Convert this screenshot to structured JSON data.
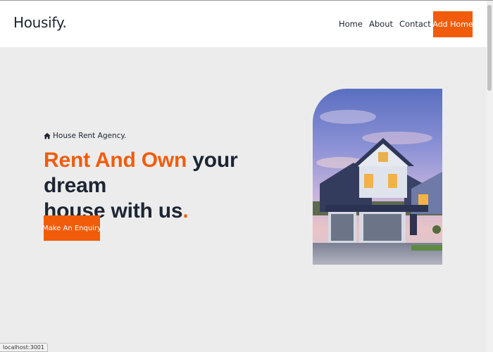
{
  "navbar": {
    "brand": "Housify.",
    "links": [
      "Home",
      "About",
      "Contact"
    ],
    "cta_label": "Add Home"
  },
  "hero": {
    "tagline": "House Rent Agency.",
    "headline_accent": "Rent And Own",
    "headline_rest_1": " your dream",
    "headline_rest_2": "house with us",
    "headline_dot": ".",
    "cta_label": "Make An Enquiry",
    "image_icon": "house-photo"
  },
  "status_bar": {
    "url": "localhost:3001"
  },
  "colors": {
    "accent": "#f15c0b",
    "text": "#1c2533",
    "background": "#ececec"
  }
}
